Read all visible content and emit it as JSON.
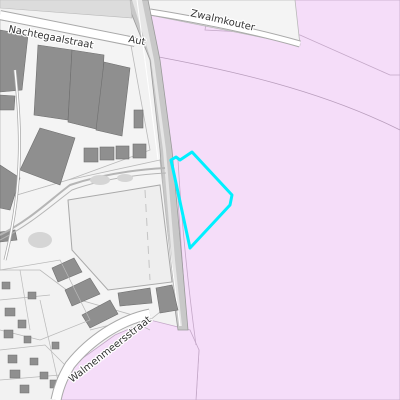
{
  "map": {
    "labels": {
      "nachtegaalstraat": "Nachtegaalstraat",
      "autosnelweg": "Aut",
      "zwalmkouter": "Zwalmkouter",
      "walmenmeersstraat": "Walmenmeersstraat"
    },
    "colors": {
      "background": "#f2f2f2",
      "zone_fill": "#f5ddf9",
      "zone_outline": "#c4a8c8",
      "building_fill": "#8f8f8f",
      "building_stroke": "#6f6f6f",
      "road_fill": "#ffffff",
      "road_casing": "#a9a9a9",
      "parcel_line": "#b9b9b9",
      "open_area": "#eeeeee",
      "highlight_parcel": "#00f0ff"
    }
  }
}
